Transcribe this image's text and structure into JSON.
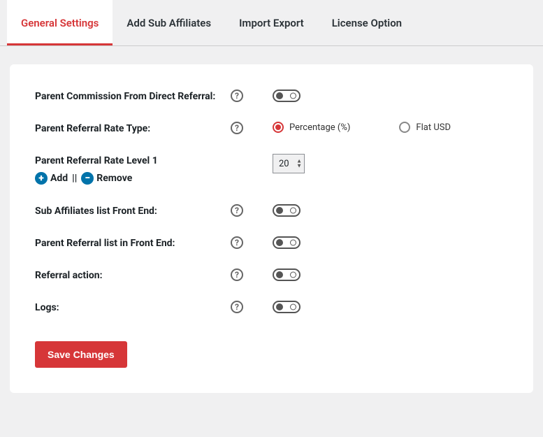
{
  "tabs": {
    "general": "General Settings",
    "sub": "Add Sub Affiliates",
    "import": "Import Export",
    "license": "License Option"
  },
  "labels": {
    "parent_commission": "Parent Commission From Direct Referral:",
    "rate_type": "Parent Referral Rate Type:",
    "rate_level_1": "Parent Referral Rate Level 1",
    "sub_list": "Sub Affiliates list Front End:",
    "parent_list": "Parent Referral list in Front End:",
    "referral_action": "Referral action:",
    "logs": "Logs:"
  },
  "rate_type_options": {
    "percentage": "Percentage (%)",
    "flat": "Flat USD"
  },
  "values": {
    "rate_level_1": "20"
  },
  "add_remove": {
    "add": "Add",
    "sep": " || ",
    "remove": "Remove"
  },
  "buttons": {
    "save": "Save Changes"
  },
  "help_glyph": "?"
}
